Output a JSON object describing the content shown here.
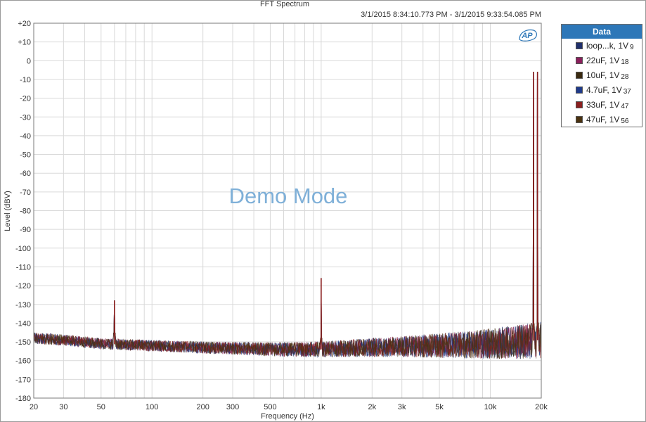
{
  "chart_data": {
    "type": "line",
    "title": "FFT Spectrum",
    "subtitle": "3/1/2015 8:34:10.773 PM - 3/1/2015 9:33:54.085 PM",
    "xlabel": "Frequency (Hz)",
    "ylabel": "Level (dBV)",
    "x_scale": "log",
    "xlim": [
      20,
      20000
    ],
    "ylim": [
      -180,
      20
    ],
    "grid": true,
    "watermark": "Demo Mode",
    "logo": "AP",
    "legend_title": "Data",
    "legend_position": "right",
    "x_ticks": [
      {
        "v": 20,
        "label": "20"
      },
      {
        "v": 30,
        "label": "30"
      },
      {
        "v": 50,
        "label": "50"
      },
      {
        "v": 100,
        "label": "100"
      },
      {
        "v": 200,
        "label": "200"
      },
      {
        "v": 300,
        "label": "300"
      },
      {
        "v": 500,
        "label": "500"
      },
      {
        "v": 1000,
        "label": "1k"
      },
      {
        "v": 2000,
        "label": "2k"
      },
      {
        "v": 3000,
        "label": "3k"
      },
      {
        "v": 5000,
        "label": "5k"
      },
      {
        "v": 10000,
        "label": "10k"
      },
      {
        "v": 20000,
        "label": "20k"
      }
    ],
    "x_minor_ticks": [
      40,
      60,
      70,
      80,
      90,
      400,
      600,
      700,
      800,
      900,
      4000,
      6000,
      7000,
      8000,
      9000
    ],
    "y_ticks": [
      {
        "v": 20,
        "label": "+20"
      },
      {
        "v": 10,
        "label": "+10"
      },
      {
        "v": 0,
        "label": "0"
      },
      {
        "v": -10,
        "label": "-10"
      },
      {
        "v": -20,
        "label": "-20"
      },
      {
        "v": -30,
        "label": "-30"
      },
      {
        "v": -40,
        "label": "-40"
      },
      {
        "v": -50,
        "label": "-50"
      },
      {
        "v": -60,
        "label": "-60"
      },
      {
        "v": -70,
        "label": "-70"
      },
      {
        "v": -80,
        "label": "-80"
      },
      {
        "v": -90,
        "label": "-90"
      },
      {
        "v": -100,
        "label": "-100"
      },
      {
        "v": -110,
        "label": "-110"
      },
      {
        "v": -120,
        "label": "-120"
      },
      {
        "v": -130,
        "label": "-130"
      },
      {
        "v": -140,
        "label": "-140"
      },
      {
        "v": -150,
        "label": "-150"
      },
      {
        "v": -160,
        "label": "-160"
      },
      {
        "v": -170,
        "label": "-170"
      },
      {
        "v": -180,
        "label": "-180"
      }
    ],
    "series": [
      {
        "name": "loop...k, 1V",
        "index": "9",
        "color": "#1f2f6b"
      },
      {
        "name": "22uF, 1V",
        "index": "18",
        "color": "#8a1f5c"
      },
      {
        "name": "10uF, 1V",
        "index": "28",
        "color": "#3a2a10"
      },
      {
        "name": "4.7uF, 1V",
        "index": "37",
        "color": "#1f3a8a"
      },
      {
        "name": "33uF, 1V",
        "index": "47",
        "color": "#8a1f1f"
      },
      {
        "name": "47uF, 1V",
        "index": "56",
        "color": "#4a3210"
      }
    ],
    "noise_floor": [
      {
        "x": 20,
        "y": -148
      },
      {
        "x": 30,
        "y": -149
      },
      {
        "x": 50,
        "y": -151
      },
      {
        "x": 100,
        "y": -152
      },
      {
        "x": 200,
        "y": -153
      },
      {
        "x": 500,
        "y": -154
      },
      {
        "x": 1000,
        "y": -154
      },
      {
        "x": 2000,
        "y": -153
      },
      {
        "x": 5000,
        "y": -152
      },
      {
        "x": 10000,
        "y": -151
      },
      {
        "x": 15000,
        "y": -150
      },
      {
        "x": 20000,
        "y": -149
      }
    ],
    "peaks": [
      {
        "x": 60,
        "y": -128
      },
      {
        "x": 1000,
        "y": -116
      },
      {
        "x": 18000,
        "y": -6
      },
      {
        "x": 19000,
        "y": -6
      }
    ]
  }
}
